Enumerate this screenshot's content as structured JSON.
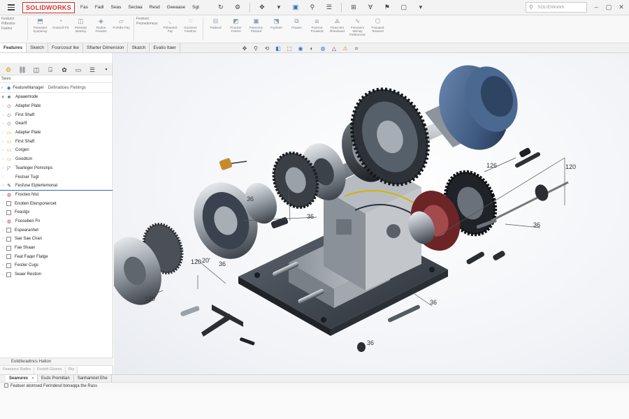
{
  "app": {
    "logo": "SOLIDWORKS",
    "menu": [
      "Fas",
      "Fadl",
      "Seas",
      "Sectaa",
      "Resd",
      "Geeaase",
      "Sgt"
    ],
    "search_placeholder": "SOLIDWorkh"
  },
  "ribbon": {
    "text_group": [
      "Featuon",
      "Pdtestos",
      "Fastnu"
    ],
    "text_group2": [
      "Featuon",
      "Peonedoneys"
    ],
    "buttons": [
      {
        "label": "Feanaoet Sysponoy"
      },
      {
        "label": "Gnaood Pd"
      },
      {
        "label": "Peesaar Iaessoy"
      },
      {
        "label": "Rodoe Feowes"
      },
      {
        "label": "Forstbs Fay"
      },
      {
        "label": "Pnhaoerd Fay"
      },
      {
        "label": "Goonece Feeshor"
      },
      {
        "label": "Fwdsod"
      },
      {
        "label": "Fnonrer Feesrs"
      },
      {
        "label": "Pasnome Pssoed"
      },
      {
        "label": "Foyhare"
      },
      {
        "label": "Fraaee"
      },
      {
        "label": "Feornor Pcrawod"
      },
      {
        "label": "Peaccem Rheesaod"
      },
      {
        "label": "Fesvoem Wenay Fedouncoe"
      },
      {
        "label": "Fesaaed Tesanen"
      }
    ]
  },
  "tabs": [
    "Features",
    "Sketch",
    "Fosrcosut Ike",
    "Sfiarter Dimension",
    "Skatch",
    "Evalio Itaer"
  ],
  "panel": {
    "filter": "Sees",
    "header": "FeatureManager",
    "header_sub": "Definatioes Fletiings",
    "tree": [
      {
        "label": "Apaaemode",
        "icon": "part"
      },
      {
        "label": "Adapter Plate",
        "icon": "feature"
      },
      {
        "label": "First Shaft",
        "icon": "feature"
      },
      {
        "label": "Gearlf",
        "icon": "feature"
      },
      {
        "label": "Adapter Plate",
        "icon": "folder"
      },
      {
        "label": "First Shaft",
        "icon": "folder"
      },
      {
        "label": "Corgen",
        "icon": "folder"
      },
      {
        "label": "Goodtcin",
        "icon": "folder"
      },
      {
        "label": "Tearteger Pomsinps",
        "icon": "sketch"
      },
      {
        "label": "Festser Tugt",
        "icon": "none"
      },
      {
        "label": "Fesfuse Eiptertemonal",
        "icon": "pin",
        "selected": true
      },
      {
        "label": "Fnscteo Nist",
        "icon": "red"
      },
      {
        "label": "Enotlen Etersponeroet",
        "icon": "box"
      },
      {
        "label": "Feastgx",
        "icon": "box"
      },
      {
        "label": "Fooseben Fn",
        "icon": "red"
      },
      {
        "label": "Espearanhet",
        "icon": "box"
      },
      {
        "label": "Sae Sae Chan",
        "icon": "box"
      },
      {
        "label": "Fae Shaan",
        "icon": "box"
      },
      {
        "label": "Feat Faqer Flatge",
        "icon": "box"
      },
      {
        "label": "Festier Cugs",
        "icon": "box"
      },
      {
        "label": "Seaer Restion",
        "icon": "box"
      }
    ],
    "footer": "EolidIeradmcs Hation",
    "footer_tabs": [
      "Feaearcs Sodes",
      "Fcotsh Giones",
      "Fky"
    ]
  },
  "bottom_tabs": [
    "Seanures",
    "Euds Premitian",
    "Sanhamnet Ehe"
  ],
  "status_text": "Featuer atomsed Ferindesd bonaqqa the Rass",
  "viewport": {
    "dimensions": [
      "120",
      "36",
      "20'",
      "36",
      "36",
      "120",
      "126",
      "36",
      "36",
      "36",
      "120"
    ]
  },
  "colors": {
    "accent": "#2d6db5",
    "logo_red": "#d9302c",
    "motor_blue": "#3f5a80"
  }
}
